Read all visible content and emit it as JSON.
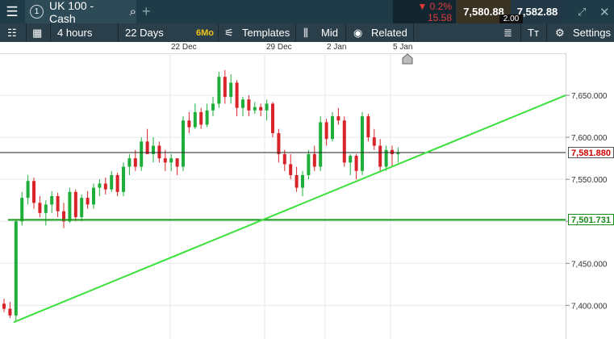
{
  "topbar": {
    "instrument_number": "1",
    "instrument": "UK 100 - Cash",
    "change_pct": "▼ 0.2%",
    "change_pts": "15.58",
    "sell_price": "7,580.88",
    "buy_price": "7,582.88",
    "spread": "2.00"
  },
  "toolbar": {
    "interval": "4 hours",
    "range": "22 Days",
    "range_badge": "6Mo",
    "templates": "Templates",
    "price_type": "Mid",
    "related": "Related",
    "settings": "Settings"
  },
  "date_axis": [
    "22 Dec",
    "29 Dec",
    "2 Jan",
    "5 Jan"
  ],
  "chart_data": {
    "type": "candlestick",
    "y_ticks": [
      "7,650.000",
      "7,600.000",
      "7,550.000",
      "7,500.000",
      "7,450.000",
      "7,400.000"
    ],
    "ylim": [
      7360,
      7700
    ],
    "current_price_label": "7,581.880",
    "horizontal_line_label": "7,501.731",
    "current_price": 7581.88,
    "horizontal_line": 7501.731,
    "trendline": [
      [
        7380,
        7650
      ]
    ],
    "up_color": "#1fae3a",
    "down_color": "#d8232a",
    "candles": [
      [
        7402,
        7408,
        7392,
        7396
      ],
      [
        7396,
        7404,
        7385,
        7388
      ],
      [
        7388,
        7502,
        7380,
        7500
      ],
      [
        7500,
        7535,
        7495,
        7528
      ],
      [
        7528,
        7555,
        7520,
        7548
      ],
      [
        7548,
        7552,
        7515,
        7522
      ],
      [
        7522,
        7530,
        7505,
        7510
      ],
      [
        7510,
        7525,
        7495,
        7520
      ],
      [
        7520,
        7536,
        7510,
        7530
      ],
      [
        7530,
        7534,
        7505,
        7512
      ],
      [
        7512,
        7522,
        7492,
        7500
      ],
      [
        7500,
        7540,
        7498,
        7535
      ],
      [
        7535,
        7538,
        7500,
        7505
      ],
      [
        7505,
        7532,
        7500,
        7528
      ],
      [
        7528,
        7536,
        7515,
        7520
      ],
      [
        7520,
        7545,
        7515,
        7540
      ],
      [
        7540,
        7550,
        7530,
        7545
      ],
      [
        7545,
        7552,
        7532,
        7538
      ],
      [
        7538,
        7560,
        7535,
        7555
      ],
      [
        7555,
        7558,
        7530,
        7535
      ],
      [
        7535,
        7570,
        7530,
        7565
      ],
      [
        7565,
        7580,
        7555,
        7575
      ],
      [
        7575,
        7585,
        7560,
        7565
      ],
      [
        7565,
        7600,
        7560,
        7595
      ],
      [
        7595,
        7610,
        7585,
        7580
      ],
      [
        7580,
        7600,
        7570,
        7590
      ],
      [
        7590,
        7595,
        7570,
        7575
      ],
      [
        7575,
        7585,
        7560,
        7570
      ],
      [
        7570,
        7580,
        7560,
        7575
      ],
      [
        7575,
        7572,
        7555,
        7565
      ],
      [
        7565,
        7625,
        7560,
        7620
      ],
      [
        7620,
        7630,
        7605,
        7612
      ],
      [
        7612,
        7640,
        7610,
        7630
      ],
      [
        7630,
        7635,
        7610,
        7615
      ],
      [
        7615,
        7640,
        7612,
        7632
      ],
      [
        7632,
        7648,
        7625,
        7640
      ],
      [
        7640,
        7678,
        7635,
        7672
      ],
      [
        7672,
        7680,
        7640,
        7648
      ],
      [
        7648,
        7675,
        7640,
        7665
      ],
      [
        7665,
        7668,
        7625,
        7635
      ],
      [
        7635,
        7648,
        7625,
        7645
      ],
      [
        7645,
        7650,
        7625,
        7632
      ],
      [
        7632,
        7642,
        7628,
        7636
      ],
      [
        7636,
        7640,
        7625,
        7632
      ],
      [
        7632,
        7645,
        7620,
        7640
      ],
      [
        7640,
        7642,
        7600,
        7605
      ],
      [
        7605,
        7610,
        7570,
        7580
      ],
      [
        7580,
        7585,
        7560,
        7568
      ],
      [
        7568,
        7580,
        7550,
        7555
      ],
      [
        7555,
        7565,
        7535,
        7540
      ],
      [
        7540,
        7560,
        7530,
        7555
      ],
      [
        7555,
        7585,
        7550,
        7580
      ],
      [
        7580,
        7590,
        7560,
        7565
      ],
      [
        7565,
        7625,
        7560,
        7618
      ],
      [
        7618,
        7622,
        7590,
        7598
      ],
      [
        7598,
        7630,
        7595,
        7625
      ],
      [
        7625,
        7635,
        7615,
        7620
      ],
      [
        7620,
        7625,
        7565,
        7570
      ],
      [
        7570,
        7580,
        7555,
        7578
      ],
      [
        7578,
        7580,
        7550,
        7560
      ],
      [
        7560,
        7630,
        7555,
        7625
      ],
      [
        7625,
        7628,
        7595,
        7600
      ],
      [
        7600,
        7610,
        7585,
        7590
      ],
      [
        7590,
        7598,
        7560,
        7565
      ],
      [
        7565,
        7590,
        7560,
        7585
      ],
      [
        7585,
        7590,
        7565,
        7580
      ],
      [
        7580,
        7588,
        7570,
        7582
      ]
    ]
  }
}
